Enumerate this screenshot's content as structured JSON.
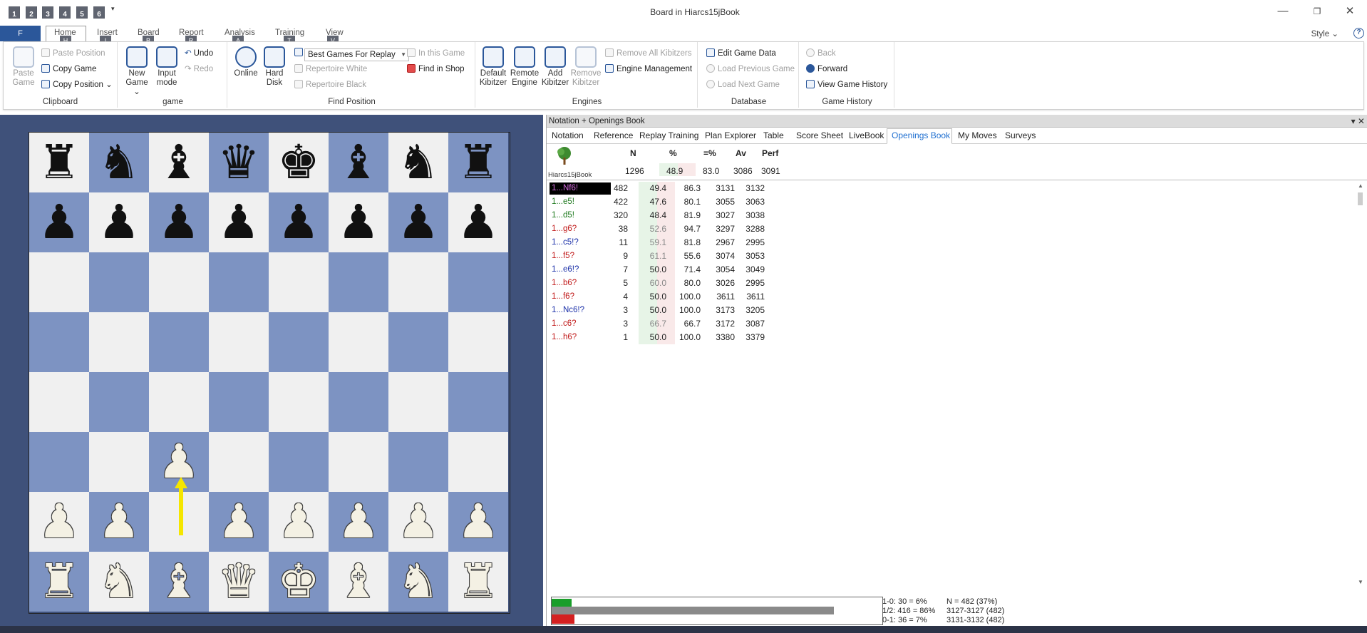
{
  "quick_access": [
    "1",
    "2",
    "3",
    "4",
    "5",
    "6"
  ],
  "window_title": "Board in Hiarcs15jBook",
  "window_controls": {
    "minimize": "—",
    "restore": "❐",
    "close": "✕"
  },
  "ribbon_tabs": {
    "file": "F",
    "items": [
      {
        "label": "Home",
        "key": "H"
      },
      {
        "label": "Insert",
        "key": "I"
      },
      {
        "label": "Board",
        "key": "B"
      },
      {
        "label": "Report",
        "key": "R"
      },
      {
        "label": "Analysis",
        "key": "A"
      },
      {
        "label": "Training",
        "key": "T"
      },
      {
        "label": "View",
        "key": "V"
      }
    ],
    "style": "Style ⌄",
    "help": "?"
  },
  "clipboard": {
    "paste_game": "Paste\nGame",
    "paste_position": "Paste Position",
    "copy_game": "Copy Game",
    "copy_position": "Copy Position ⌄",
    "group": "Clipboard"
  },
  "game": {
    "new_game": "New\nGame ⌄",
    "input_mode": "Input\nmode",
    "undo": "Undo",
    "redo": "Redo",
    "group": "game"
  },
  "find_position": {
    "online": "Online",
    "hard_disk": "Hard\nDisk",
    "dropdown": "Best Games For Replay",
    "in_this_game": "In this Game",
    "find_in_shop": "Find in Shop",
    "rep_white": "Repertoire White",
    "rep_black": "Repertoire Black",
    "group": "Find Position"
  },
  "engines": {
    "default_kibitzer": "Default\nKibitzer",
    "remote_engine": "Remote\nEngine",
    "add_kibitzer": "Add\nKibitzer",
    "remove_kibitzer": "Remove\nKibitzer",
    "remove_all": "Remove All Kibitzers",
    "engine_management": "Engine Management",
    "group": "Engines"
  },
  "database": {
    "edit_game_data": "Edit Game Data",
    "load_prev": "Load Previous Game",
    "load_next": "Load Next Game",
    "group": "Database"
  },
  "history": {
    "back": "Back",
    "forward": "Forward",
    "view_history": "View Game History",
    "group": "Game History"
  },
  "board": {
    "rows": [
      [
        "r",
        "n",
        "b",
        "q",
        "k",
        "b",
        "n",
        "r"
      ],
      [
        "p",
        "p",
        "p",
        "p",
        "p",
        "p",
        "p",
        "p"
      ],
      [
        "",
        "",
        "",
        "",
        "",
        "",
        "",
        ""
      ],
      [
        "",
        "",
        "",
        "",
        "",
        "",
        "",
        ""
      ],
      [
        "",
        "",
        "",
        "",
        "",
        "",
        "",
        ""
      ],
      [
        "",
        "",
        "P",
        "",
        "",
        "",
        "",
        ""
      ],
      [
        "P",
        "P",
        "",
        "P",
        "P",
        "P",
        "P",
        "P"
      ],
      [
        "R",
        "N",
        "B",
        "Q",
        "K",
        "B",
        "N",
        "R"
      ]
    ],
    "arrow_color": "#f5e600"
  },
  "panel": {
    "title": "Notation + Openings Book",
    "controls": "▾ ✕",
    "tabs": [
      "Notation",
      "Reference",
      "Replay Training",
      "Plan Explorer",
      "Table",
      "Score Sheet",
      "LiveBook",
      "Openings Book",
      "My Moves",
      "Surveys"
    ],
    "active_tab": "Openings Book",
    "book_name": "Hiarcs15jBook",
    "headers": {
      "n": "N",
      "pct": "%",
      "draw": "=%",
      "av": "Av",
      "perf": "Perf"
    },
    "summary": {
      "n": "1296",
      "pct": "48.9",
      "draw": "83.0",
      "av": "3086",
      "perf": "3091"
    },
    "moves": [
      {
        "move": "1...Nf6!",
        "n": "482",
        "pct": "49.4",
        "draw": "86.3",
        "av": "3131",
        "perf": "3132",
        "color": "#d66de0",
        "selected": true
      },
      {
        "move": "1...e5!",
        "n": "422",
        "pct": "47.6",
        "draw": "80.1",
        "av": "3055",
        "perf": "3063",
        "color": "#1f7a1f",
        "selected": false
      },
      {
        "move": "1...d5!",
        "n": "320",
        "pct": "48.4",
        "draw": "81.9",
        "av": "3027",
        "perf": "3038",
        "color": "#1f7a1f",
        "selected": false
      },
      {
        "move": "1...g6?",
        "n": "38",
        "pct": "52.6",
        "draw": "94.7",
        "av": "3297",
        "perf": "3288",
        "color": "#c01818",
        "selected": false
      },
      {
        "move": "1...c5!?",
        "n": "11",
        "pct": "59.1",
        "draw": "81.8",
        "av": "2967",
        "perf": "2995",
        "color": "#1a2fa8",
        "selected": false
      },
      {
        "move": "1...f5?",
        "n": "9",
        "pct": "61.1",
        "draw": "55.6",
        "av": "3074",
        "perf": "3053",
        "color": "#c01818",
        "selected": false
      },
      {
        "move": "1...e6!?",
        "n": "7",
        "pct": "50.0",
        "draw": "71.4",
        "av": "3054",
        "perf": "3049",
        "color": "#1a2fa8",
        "selected": false
      },
      {
        "move": "1...b6?",
        "n": "5",
        "pct": "60.0",
        "draw": "80.0",
        "av": "3026",
        "perf": "2995",
        "color": "#c01818",
        "selected": false
      },
      {
        "move": "1...f6?",
        "n": "4",
        "pct": "50.0",
        "draw": "100.0",
        "av": "3611",
        "perf": "3611",
        "color": "#c01818",
        "selected": false
      },
      {
        "move": "1...Nc6!?",
        "n": "3",
        "pct": "50.0",
        "draw": "100.0",
        "av": "3173",
        "perf": "3205",
        "color": "#1a2fa8",
        "selected": false
      },
      {
        "move": "1...c6?",
        "n": "3",
        "pct": "66.7",
        "draw": "66.7",
        "av": "3172",
        "perf": "3087",
        "color": "#c01818",
        "selected": false
      },
      {
        "move": "1...h6?",
        "n": "1",
        "pct": "50.0",
        "draw": "100.0",
        "av": "3380",
        "perf": "3379",
        "color": "#c01818",
        "selected": false
      }
    ],
    "stats": {
      "white_win": "1-0: 30 = 6%",
      "draw": "1/2: 416 = 86%",
      "black_win": "0-1: 36 = 7%",
      "n_total": "N = 482 (37%)",
      "range1": "3127-3127 (482)",
      "range2": "3131-3132 (482)",
      "white_frac": 0.06,
      "draw_frac": 0.86,
      "black_frac": 0.07
    }
  }
}
